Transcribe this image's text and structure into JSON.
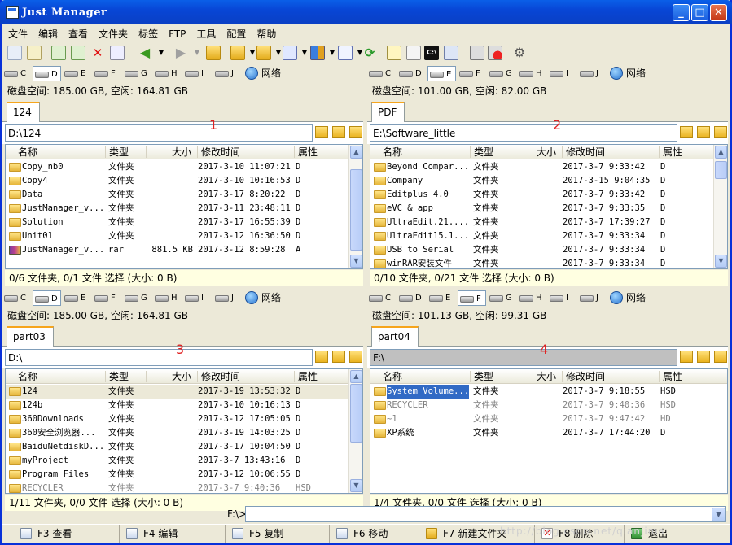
{
  "window": {
    "title": "Just Manager"
  },
  "menu": [
    "文件",
    "编辑",
    "查看",
    "文件夹",
    "标签",
    "FTP",
    "工具",
    "配置",
    "帮助"
  ],
  "drive_labels": [
    "C",
    "D",
    "E",
    "F",
    "G",
    "H",
    "I",
    "J"
  ],
  "network_label": "网络",
  "headers": {
    "name": "名称",
    "type": "类型",
    "size": "大小",
    "mtime": "修改时间",
    "attr": "属性"
  },
  "panels": [
    {
      "selected_drive": "D",
      "disk_info": "磁盘空间: 185.00 GB, 空闲: 164.81 GB",
      "tab": "124",
      "path": "D:\\124",
      "number": "1",
      "rows": [
        {
          "name": "Copy_nb0",
          "type": "文件夹",
          "size": "",
          "mtime": "2017-3-10 11:07:21",
          "attr": "D"
        },
        {
          "name": "Copy4",
          "type": "文件夹",
          "size": "",
          "mtime": "2017-3-10 10:16:53",
          "attr": "D"
        },
        {
          "name": "Data",
          "type": "文件夹",
          "size": "",
          "mtime": "2017-3-17 8:20:22",
          "attr": "D"
        },
        {
          "name": "JustManager_v...",
          "type": "文件夹",
          "size": "",
          "mtime": "2017-3-11 23:48:11",
          "attr": "D"
        },
        {
          "name": "Solution",
          "type": "文件夹",
          "size": "",
          "mtime": "2017-3-17 16:55:39",
          "attr": "D"
        },
        {
          "name": "Unit01",
          "type": "文件夹",
          "size": "",
          "mtime": "2017-3-12 16:36:50",
          "attr": "D"
        },
        {
          "name": "JustManager_v...",
          "type": "rar",
          "size": "881.5 KB",
          "mtime": "2017-3-12 8:59:28",
          "attr": "A"
        }
      ],
      "status": "0/6 文件夹, 0/1 文件 选择 (大小: 0 B)"
    },
    {
      "selected_drive": "E",
      "disk_info": "磁盘空间: 101.00 GB, 空闲: 82.00 GB",
      "tab": "PDF",
      "path": "E:\\Software_little",
      "number": "2",
      "rows": [
        {
          "name": "Beyond Compar...",
          "type": "文件夹",
          "size": "",
          "mtime": "2017-3-7 9:33:42",
          "attr": "D"
        },
        {
          "name": "Company",
          "type": "文件夹",
          "size": "",
          "mtime": "2017-3-15 9:04:35",
          "attr": "D"
        },
        {
          "name": "Editplus 4.0",
          "type": "文件夹",
          "size": "",
          "mtime": "2017-3-7 9:33:42",
          "attr": "D"
        },
        {
          "name": "eVC & app",
          "type": "文件夹",
          "size": "",
          "mtime": "2017-3-7 9:33:35",
          "attr": "D"
        },
        {
          "name": "UltraEdit.21....",
          "type": "文件夹",
          "size": "",
          "mtime": "2017-3-7 17:39:27",
          "attr": "D"
        },
        {
          "name": "UltraEdit15.1...",
          "type": "文件夹",
          "size": "",
          "mtime": "2017-3-7 9:33:34",
          "attr": "D"
        },
        {
          "name": "USB to Serial",
          "type": "文件夹",
          "size": "",
          "mtime": "2017-3-7 9:33:34",
          "attr": "D"
        },
        {
          "name": "winRAR安装文件",
          "type": "文件夹",
          "size": "",
          "mtime": "2017-3-7 9:33:34",
          "attr": "D"
        }
      ],
      "status": "0/10 文件夹, 0/21 文件 选择 (大小: 0 B)"
    },
    {
      "selected_drive": "D",
      "disk_info": "磁盘空间: 185.00 GB, 空闲: 164.81 GB",
      "tab": "part03",
      "path": "D:\\",
      "number": "3",
      "rows": [
        {
          "name": "124",
          "type": "文件夹",
          "size": "",
          "mtime": "2017-3-19 13:53:32",
          "attr": "D"
        },
        {
          "name": "124b",
          "type": "文件夹",
          "size": "",
          "mtime": "2017-3-10 10:16:13",
          "attr": "D"
        },
        {
          "name": "360Downloads",
          "type": "文件夹",
          "size": "",
          "mtime": "2017-3-12 17:05:05",
          "attr": "D"
        },
        {
          "name": "360安全浏览器...",
          "type": "文件夹",
          "size": "",
          "mtime": "2017-3-19 14:03:25",
          "attr": "D"
        },
        {
          "name": "BaiduNetdiskD...",
          "type": "文件夹",
          "size": "",
          "mtime": "2017-3-17 10:04:50",
          "attr": "D"
        },
        {
          "name": "myProject",
          "type": "文件夹",
          "size": "",
          "mtime": "2017-3-7 13:43:16",
          "attr": "D"
        },
        {
          "name": "Program Files",
          "type": "文件夹",
          "size": "",
          "mtime": "2017-3-12 10:06:55",
          "attr": "D"
        },
        {
          "name": "RECYCLER",
          "type": "文件夹",
          "size": "",
          "mtime": "2017-3-7 9:40:36",
          "attr": "HSD"
        }
      ],
      "status": "1/11 文件夹, 0/0 文件 选择 (大小: 0 B)"
    },
    {
      "selected_drive": "F",
      "disk_info": "磁盘空间: 101.13 GB, 空闲: 99.31 GB",
      "tab": "part04",
      "path": "F:\\",
      "number": "4",
      "rows": [
        {
          "name": "System Volume...",
          "type": "文件夹",
          "size": "",
          "mtime": "2017-3-7 9:18:55",
          "attr": "HSD"
        },
        {
          "name": "RECYCLER",
          "type": "文件夹",
          "size": "",
          "mtime": "2017-3-7 9:40:36",
          "attr": "HSD"
        },
        {
          "name": "~1",
          "type": "文件夹",
          "size": "",
          "mtime": "2017-3-7 9:47:42",
          "attr": "HD"
        },
        {
          "name": "XP系统",
          "type": "文件夹",
          "size": "",
          "mtime": "2017-3-7 17:44:20",
          "attr": "D"
        }
      ],
      "status": "1/4 文件夹, 0/0 文件 选择 (大小: 0 B)"
    }
  ],
  "cmdline": {
    "prompt": "F:\\>"
  },
  "fkeys": [
    {
      "key": "F3",
      "label": "查看"
    },
    {
      "key": "F4",
      "label": "编辑"
    },
    {
      "key": "F5",
      "label": "复制"
    },
    {
      "key": "F6",
      "label": "移动"
    },
    {
      "key": "F7",
      "label": "新建文件夹"
    },
    {
      "key": "F8",
      "label": "删除"
    },
    {
      "key": "",
      "label": "退出"
    }
  ],
  "watermark": "http://blog.csdn.net/qianjima"
}
